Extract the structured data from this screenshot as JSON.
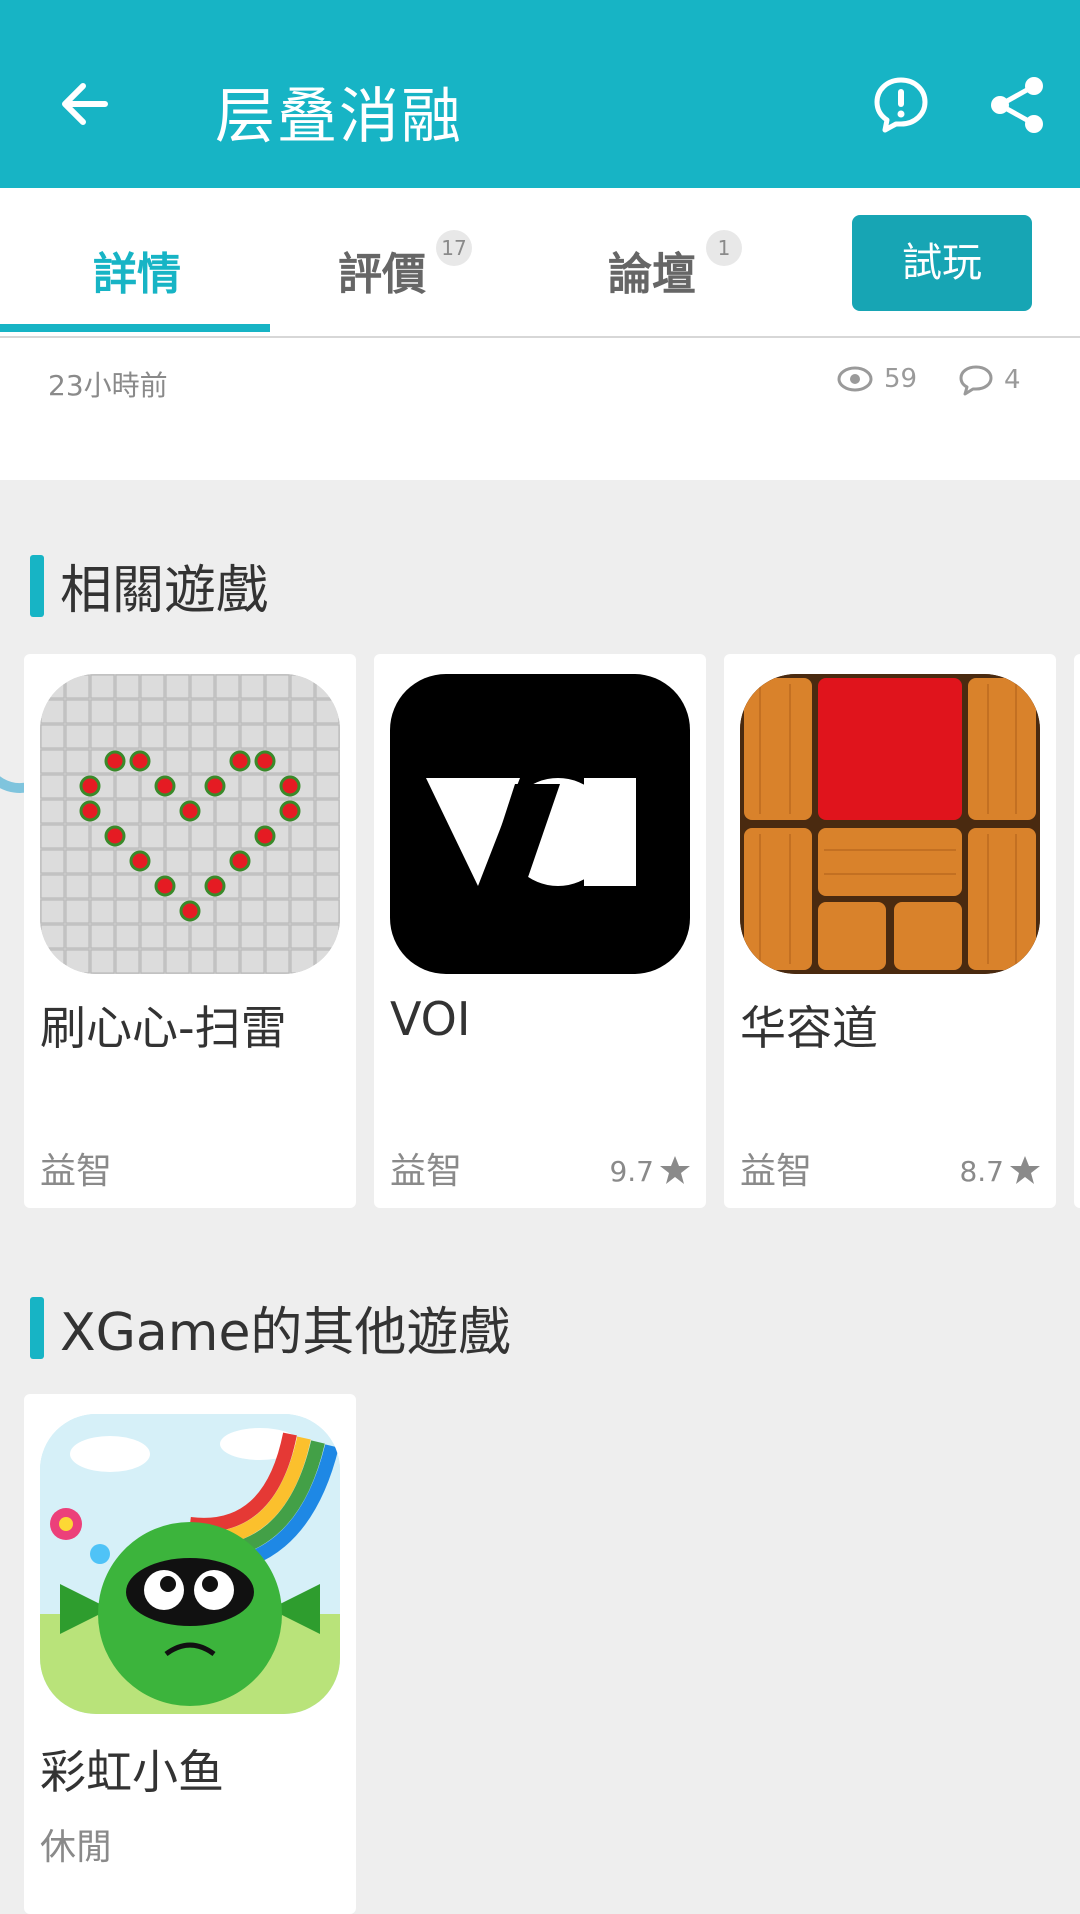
{
  "header": {
    "title": "层叠消融"
  },
  "tabs": [
    {
      "label": "詳情",
      "badge": ""
    },
    {
      "label": "評價",
      "badge": "17"
    },
    {
      "label": "論壇",
      "badge": "1"
    }
  ],
  "try_button": "試玩",
  "meta": {
    "time": "23小時前",
    "views": "59",
    "comments": "4"
  },
  "sections": {
    "related": "相關遊戲",
    "others": "XGame的其他遊戲"
  },
  "related_games": [
    {
      "name": "刷心心-扫雷",
      "category": "益智",
      "rating": ""
    },
    {
      "name": "VOI",
      "category": "益智",
      "rating": "9.7"
    },
    {
      "name": "华容道",
      "category": "益智",
      "rating": "8.7"
    }
  ],
  "other_games": [
    {
      "name": "彩虹小鱼",
      "category": "休閒"
    }
  ],
  "colors": {
    "accent": "#17b4c5",
    "button": "#17a5b4",
    "heart": "#e51b23",
    "voi_bg": "#000000"
  }
}
